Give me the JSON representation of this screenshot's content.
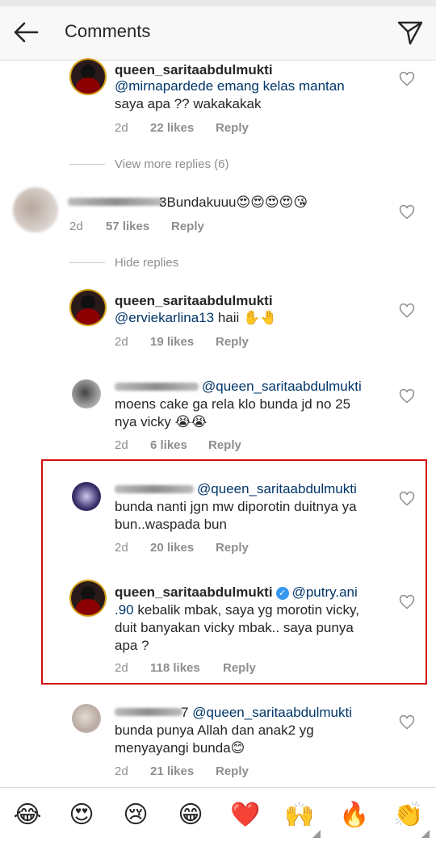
{
  "header": {
    "title": "Comments"
  },
  "comments": [
    {
      "user": "queen_saritaabdulmukti",
      "lines": [
        "@mirnapardede emang kelas mantan",
        "saya apa ?? wakakakak"
      ],
      "time": "2d",
      "likes": "22 likes",
      "reply": "Reply"
    },
    {
      "view_more": "View more replies (6)"
    },
    {
      "user_suffix": "3",
      "text": "Bundakuuu😍😍😍😍😘",
      "time": "2d",
      "likes": "57 likes",
      "reply": "Reply"
    },
    {
      "hide": "Hide replies"
    },
    {
      "user": "queen_saritaabdulmukti",
      "mention": "@erviekarlina13",
      "text": " haii ✋🤚",
      "time": "2d",
      "likes": "19 likes",
      "reply": "Reply"
    },
    {
      "mention": "@queen_saritaabdulmukti",
      "lines": [
        "moens cake ga rela klo bunda jd no 25",
        "nya vicky 😭😭"
      ],
      "time": "2d",
      "likes": "6 likes",
      "reply": "Reply"
    },
    {
      "mention": "@queen_saritaabdulmukti",
      "lines": [
        "bunda nanti jgn mw diporotin duitnya ya",
        "bun..waspada bun"
      ],
      "time": "2d",
      "likes": "20 likes",
      "reply": "Reply"
    },
    {
      "user": "queen_saritaabdulmukti",
      "verified": "✓",
      "mention_a": "@putry.ani",
      "mention_b": ".90",
      "line1_rest": " kebalik mbak, saya yg morotin vicky,",
      "lines": [
        "duit banyakan vicky mbak.. saya punya",
        "apa ?"
      ],
      "time": "2d",
      "likes": "118 likes",
      "reply": "Reply"
    },
    {
      "user_suffix": "7",
      "mention": "@queen_saritaabdulmukti",
      "lines": [
        "bunda punya Allah dan anak2 yg",
        "menyayangi bunda😊"
      ],
      "time": "2d",
      "likes": "21 likes",
      "reply": "Reply"
    }
  ],
  "emoji_bar": [
    "😂",
    "😍",
    "😢",
    "😁",
    "❤️",
    "🙌",
    "🔥",
    "👏"
  ]
}
